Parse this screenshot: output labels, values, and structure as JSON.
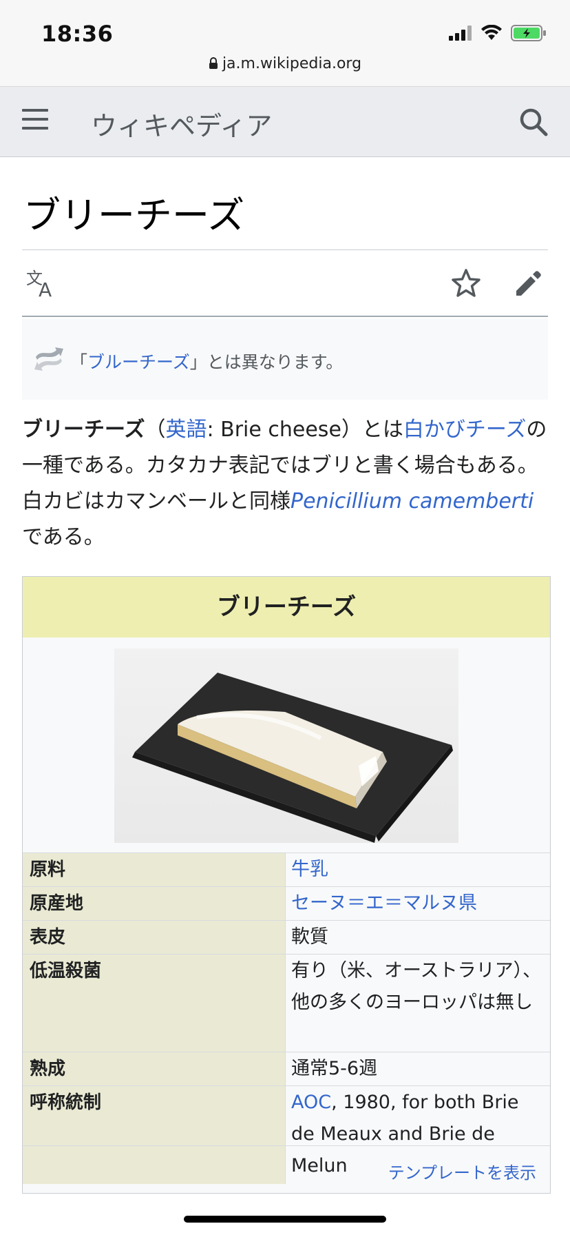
{
  "status_bar": {
    "time": "18:36",
    "url": "ja.m.wikipedia.org"
  },
  "header": {
    "site_name": "ウィキペディア"
  },
  "article": {
    "title": "ブリーチーズ",
    "hatnote": {
      "prefix": "「",
      "link": "ブルーチーズ",
      "suffix": "」とは異なります。"
    },
    "lead": {
      "bold_term": "ブリーチーズ",
      "paren_open": "（",
      "lang_link": "英語",
      "english": ": Brie cheese）とは",
      "category_link": "白かびチーズ",
      "text1": "の一種である。カタカナ表記ではブリと書く場合もある。白カビはカマンベールと同様",
      "species_link": "Penicillium camemberti",
      "text2": "である。"
    }
  },
  "infobox": {
    "title": "ブリーチーズ",
    "rows": [
      {
        "key": "原料",
        "value": "牛乳",
        "is_link": true
      },
      {
        "key": "原産地",
        "value": "セーヌ＝エ＝マルヌ県",
        "is_link": true
      },
      {
        "key": "表皮",
        "value": "軟質",
        "is_link": false
      },
      {
        "key": "低温殺菌",
        "value": "有り（米、オーストラリア）、他の多くのヨーロッパは無し",
        "is_link": false
      },
      {
        "key": "熟成",
        "value": "通常5-6週",
        "is_link": false
      }
    ],
    "aoc_row": {
      "key": "呼称統制",
      "link": "AOC",
      "rest": ", 1980, for both Brie de Meaux and Brie de Melun"
    },
    "template_link": "テンプレートを表示"
  },
  "colors": {
    "link": "#3366cc",
    "infobox_title_bg": "#eeeeb0",
    "infobox_key_bg": "#eaead4",
    "header_bg": "#eaecf0"
  },
  "icons": [
    "lock-icon",
    "signal-icon",
    "wifi-icon",
    "battery-icon",
    "menu-icon",
    "search-icon",
    "language-icon",
    "star-icon",
    "edit-icon",
    "hatnote-icon"
  ]
}
